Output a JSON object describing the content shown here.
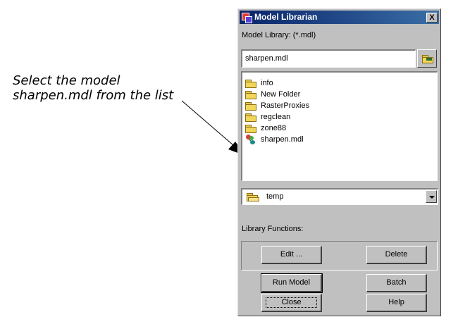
{
  "annotation": {
    "line1": "Select the model",
    "line2": "sharpen.mdl from the list"
  },
  "window": {
    "title": "Model Librarian",
    "close_label": "X",
    "library_label": "Model Library: (*.mdl)",
    "file_input_value": "sharpen.mdl",
    "files": [
      {
        "name": "info",
        "icon": "folder-icon"
      },
      {
        "name": "New Folder",
        "icon": "folder-icon"
      },
      {
        "name": "RasterProxies",
        "icon": "folder-icon"
      },
      {
        "name": "regclean",
        "icon": "folder-icon"
      },
      {
        "name": "zone88",
        "icon": "folder-icon"
      },
      {
        "name": "sharpen.mdl",
        "icon": "model-icon"
      }
    ],
    "directory": "temp",
    "functions_label": "Library Functions:",
    "buttons": {
      "edit": "Edit ...",
      "delete": "Delete",
      "run_model": "Run Model",
      "batch": "Batch",
      "close": "Close",
      "help": "Help"
    }
  },
  "colors": {
    "titlebar_start": "#0a246a",
    "titlebar_end": "#3a6ea5",
    "dialog_face": "#c0c0c0"
  }
}
